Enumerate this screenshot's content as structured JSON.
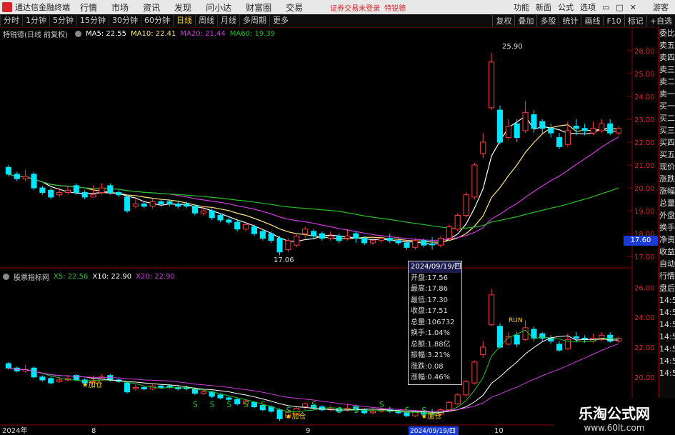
{
  "topbar": {
    "app_title": "通达信金融终端",
    "menus": [
      "行情",
      "市场",
      "资讯",
      "发现",
      "问小达",
      "财富圈",
      "交易"
    ],
    "alert": "证券交易未登录",
    "stock_name": "特锐德",
    "right_items": [
      "功能",
      "新面",
      "公式",
      "选项"
    ],
    "guest": "游客"
  },
  "tabs": [
    "分时",
    "1分钟",
    "5分钟",
    "15分钟",
    "30分钟",
    "60分钟",
    "日线",
    "周线",
    "月线",
    "多周期",
    "更多"
  ],
  "active_tab": "日线",
  "tools": [
    "复权",
    "叠加",
    "多股",
    "统计",
    "画线",
    "F10",
    "标记",
    "+自选"
  ],
  "main_legend": {
    "title": "特锐德(日线 前复权)",
    "ma5": "MA5: 22.55",
    "ma10": "MA10: 22.41",
    "ma20": "MA20: 21.44",
    "ma60": "MA60: 19.39"
  },
  "sub_legend": {
    "title": "股票指标网",
    "x5": "X5: 22.56",
    "x10": "X10: 22.90",
    "x20": "X20: 22.90"
  },
  "main_axis": [
    "26.00",
    "25.00",
    "24.00",
    "23.00",
    "22.00",
    "21.00",
    "20.00",
    "19.00",
    "18.00",
    "17.00"
  ],
  "sub_axis": [
    "26.00",
    "24.00",
    "22.00",
    "20.00"
  ],
  "price_badge": "17.60",
  "annotations": {
    "high": "25.90",
    "low": "17.06"
  },
  "signals": {
    "add": "加仓",
    "buy": "S",
    "run": "RUN"
  },
  "x_axis": [
    "2024年",
    "8",
    "9",
    "2024/09/19/四",
    "10"
  ],
  "tooltip": {
    "date": "2024/09/19/四",
    "open": "开盘:17.56",
    "high": "最高:17.86",
    "low": "最低:17.30",
    "close": "收盘:17.51",
    "volume": "总量:106732",
    "turnover": "换手:1.04%",
    "amount": "总额:1.88亿",
    "amplitude": "振幅:3.21%",
    "change": "涨跌:0.08",
    "pct": "涨幅:0.46%"
  },
  "side_panel": [
    "委比",
    "卖五",
    "卖四",
    "卖三",
    "卖二",
    "卖一",
    "买一",
    "买二",
    "买三",
    "买四",
    "买五",
    "现价",
    "涨跌",
    "涨幅",
    "总量",
    "外盘",
    "换手",
    "净资",
    "收益",
    "自动",
    "行情",
    "盘后",
    "14:50",
    "14:50",
    "14:50",
    "14:50",
    "14:50",
    "14:50",
    "14:50"
  ],
  "watermark": {
    "title": "乐淘公式网",
    "url": "www.60lt.com"
  },
  "colors": {
    "up": "#ff3b3b",
    "down": "#00e5ff",
    "ma5": "#ffffff",
    "ma10": "#ffe680",
    "ma20": "#d13be0",
    "ma60": "#26c026"
  },
  "chart_data": {
    "type": "candlestick",
    "title": "特锐德(日线 前复权)",
    "ylim": [
      16.6,
      26.4
    ],
    "candles": [
      [
        20.9,
        20.6,
        21.0,
        20.5
      ],
      [
        20.6,
        20.4,
        20.7,
        20.3
      ],
      [
        20.4,
        20.5,
        20.8,
        20.3
      ],
      [
        20.6,
        20.0,
        20.7,
        19.9
      ],
      [
        20.0,
        19.8,
        20.1,
        19.7
      ],
      [
        19.9,
        19.6,
        20.0,
        19.5
      ],
      [
        19.7,
        19.8,
        20.0,
        19.6
      ],
      [
        19.8,
        19.9,
        20.1,
        19.7
      ],
      [
        20.1,
        19.8,
        20.2,
        19.7
      ],
      [
        19.8,
        19.6,
        19.9,
        19.5
      ],
      [
        19.6,
        19.7,
        20.1,
        19.6
      ],
      [
        19.8,
        20.0,
        20.2,
        19.7
      ],
      [
        20.1,
        19.8,
        20.2,
        19.7
      ],
      [
        19.8,
        19.7,
        19.9,
        19.6
      ],
      [
        19.6,
        19.0,
        19.7,
        18.9
      ],
      [
        19.2,
        19.3,
        19.5,
        19.1
      ],
      [
        19.3,
        19.2,
        19.4,
        19.1
      ],
      [
        19.2,
        19.4,
        19.5,
        19.1
      ],
      [
        19.4,
        19.3,
        19.5,
        19.2
      ],
      [
        19.4,
        19.3,
        19.5,
        19.2
      ],
      [
        19.3,
        19.2,
        19.4,
        19.1
      ],
      [
        19.3,
        19.2,
        19.4,
        19.1
      ],
      [
        19.2,
        18.9,
        19.3,
        18.8
      ],
      [
        18.9,
        19.0,
        19.2,
        18.8
      ],
      [
        19.0,
        18.7,
        19.1,
        18.6
      ],
      [
        18.8,
        18.6,
        18.9,
        18.5
      ],
      [
        18.6,
        18.5,
        18.7,
        18.4
      ],
      [
        18.5,
        18.2,
        18.6,
        18.1
      ],
      [
        18.2,
        18.4,
        18.5,
        18.1
      ],
      [
        18.3,
        18.0,
        18.4,
        17.9
      ],
      [
        18.1,
        17.8,
        18.2,
        17.7
      ],
      [
        18.0,
        17.7,
        18.1,
        17.6
      ],
      [
        17.8,
        17.2,
        17.9,
        17.06
      ],
      [
        17.3,
        17.7,
        17.8,
        17.2
      ],
      [
        17.5,
        17.9,
        18.0,
        17.4
      ],
      [
        18.0,
        18.2,
        18.3,
        17.8
      ],
      [
        18.1,
        17.9,
        18.2,
        17.8
      ],
      [
        18.0,
        17.8,
        18.1,
        17.7
      ],
      [
        17.8,
        17.9,
        18.1,
        17.7
      ],
      [
        17.9,
        17.7,
        18.0,
        17.6
      ],
      [
        17.8,
        17.9,
        18.2,
        17.7
      ],
      [
        18.0,
        17.8,
        18.1,
        17.6
      ],
      [
        17.8,
        17.6,
        17.9,
        17.5
      ],
      [
        17.6,
        17.7,
        17.9,
        17.5
      ],
      [
        17.7,
        17.8,
        17.9,
        17.6
      ],
      [
        17.8,
        17.7,
        18.0,
        17.6
      ],
      [
        17.7,
        17.6,
        17.8,
        17.5
      ],
      [
        17.6,
        17.4,
        17.7,
        17.3
      ],
      [
        17.4,
        17.7,
        17.8,
        17.3
      ],
      [
        17.7,
        17.5,
        17.8,
        17.4
      ],
      [
        17.56,
        17.51,
        17.86,
        17.3
      ],
      [
        17.5,
        17.8,
        17.9,
        17.4
      ],
      [
        17.8,
        18.3,
        18.4,
        17.7
      ],
      [
        18.2,
        18.8,
        18.9,
        18.1
      ],
      [
        18.8,
        19.7,
        19.8,
        18.7
      ],
      [
        19.6,
        21.0,
        21.1,
        19.5
      ],
      [
        21.5,
        22.0,
        22.4,
        21.3
      ],
      [
        23.5,
        25.5,
        25.9,
        23.4
      ],
      [
        23.4,
        22.0,
        23.6,
        21.9
      ],
      [
        22.2,
        22.7,
        23.0,
        22.1
      ],
      [
        22.8,
        22.2,
        23.0,
        22.0
      ],
      [
        22.5,
        23.3,
        23.8,
        22.4
      ],
      [
        23.2,
        22.6,
        23.4,
        22.4
      ],
      [
        22.9,
        22.6,
        23.0,
        22.4
      ],
      [
        22.6,
        22.4,
        22.8,
        22.2
      ],
      [
        22.2,
        21.8,
        22.4,
        21.7
      ],
      [
        21.9,
        22.5,
        22.9,
        21.8
      ],
      [
        22.7,
        22.6,
        23.0,
        22.3
      ],
      [
        22.6,
        22.5,
        22.8,
        22.3
      ],
      [
        22.4,
        22.6,
        22.9,
        22.3
      ],
      [
        22.5,
        22.8,
        23.0,
        22.4
      ],
      [
        22.8,
        22.4,
        23.0,
        22.3
      ],
      [
        22.4,
        22.6,
        22.7,
        22.3
      ]
    ],
    "ma_series": [
      "MA5",
      "MA10",
      "MA20",
      "MA60"
    ]
  }
}
